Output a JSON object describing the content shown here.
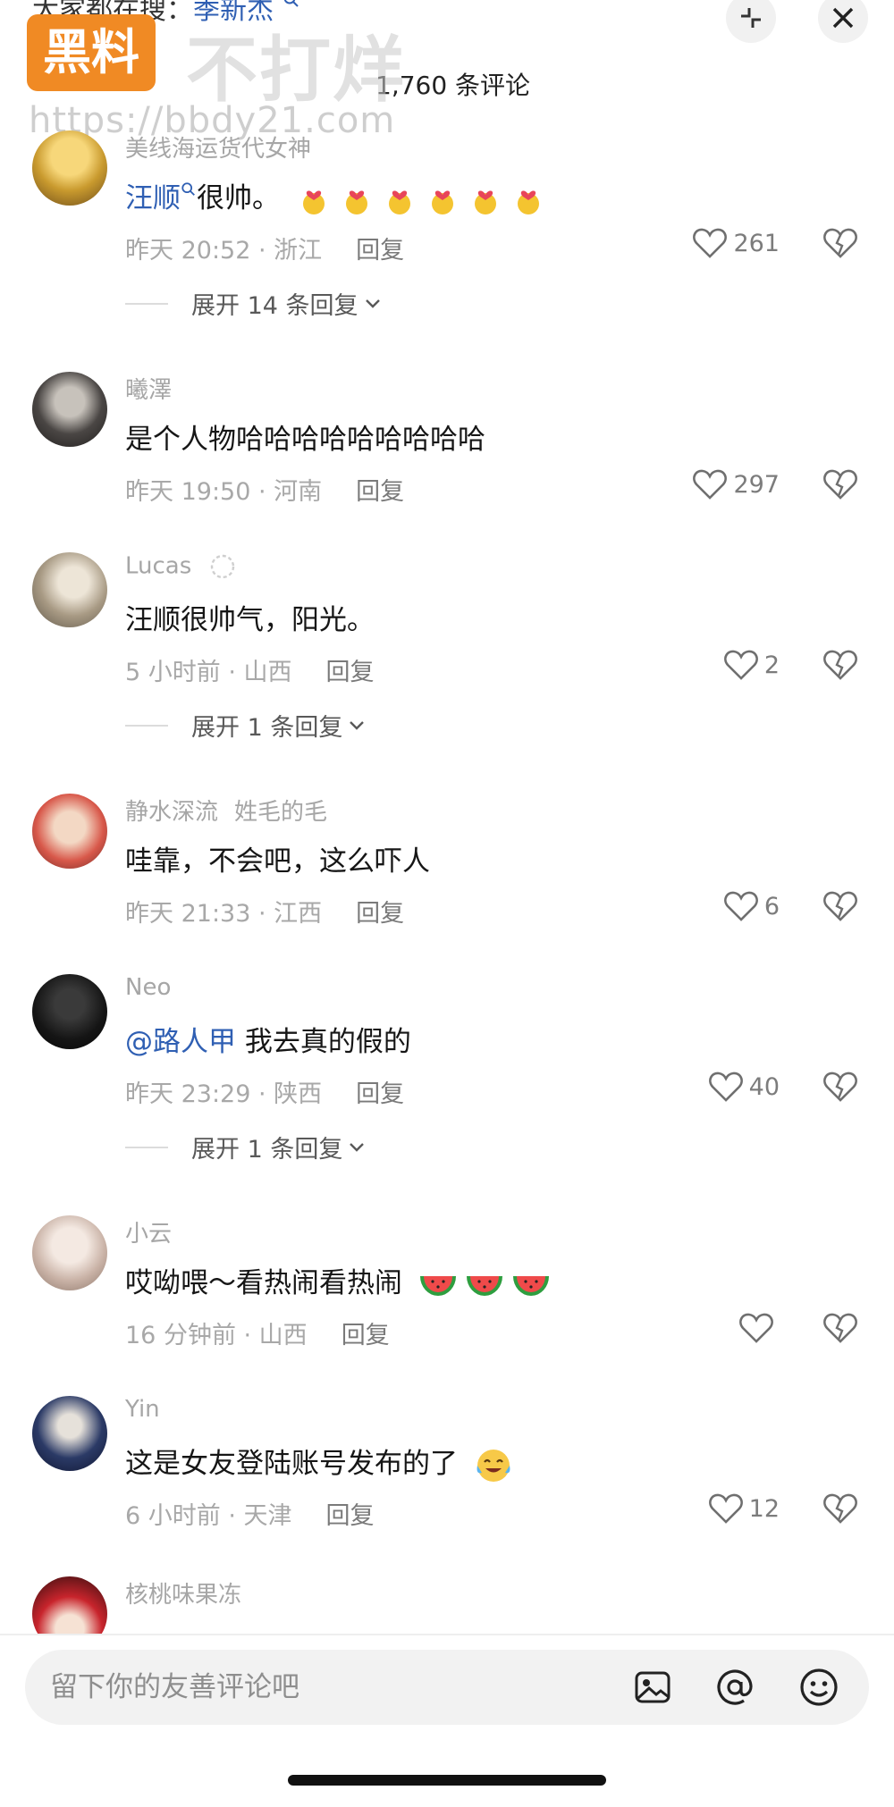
{
  "header": {
    "search_prefix": "大家都在搜：",
    "search_keyword": "季新杰",
    "comment_count": "1,760 条评论"
  },
  "watermark": {
    "logo_text": "黑料",
    "slogan": "不打烊",
    "url": "https://bbdy21.com"
  },
  "comments": [
    {
      "name": "美线海运货代女神",
      "mention": "汪顺",
      "text": "很帅。",
      "time_loc": "昨天 20:52 · 浙江",
      "reply": "回复",
      "likes": "261",
      "expand": "展开 14 条回复"
    },
    {
      "name": "曦澤",
      "text": "是个人物哈哈哈哈哈哈哈哈哈",
      "time_loc": "昨天 19:50 · 河南",
      "reply": "回复",
      "likes": "297"
    },
    {
      "name": "Lucas",
      "text": "汪顺很帅气，阳光。",
      "time_loc": "5 小时前 · 山西",
      "reply": "回复",
      "likes": "2",
      "expand": "展开 1 条回复"
    },
    {
      "name": "静水深流",
      "name_extra": "姓毛的毛",
      "text": "哇靠，不会吧，这么吓人",
      "time_loc": "昨天 21:33 · 江西",
      "reply": "回复",
      "likes": "6"
    },
    {
      "name": "Neo",
      "mention": "@路人甲",
      "text": " 我去真的假的",
      "time_loc": "昨天 23:29 · 陕西",
      "reply": "回复",
      "likes": "40",
      "expand": "展开 1 条回复"
    },
    {
      "name": "小云",
      "text": "哎呦喂～看热闹看热闹",
      "time_loc": "16 分钟前 · 山西",
      "reply": "回复",
      "likes": ""
    },
    {
      "name": "Yin",
      "text": "这是女友登陆账号发布的了",
      "time_loc": "6 小时前 · 天津",
      "reply": "回复",
      "likes": "12"
    },
    {
      "name": "核桃味果冻"
    }
  ],
  "input": {
    "placeholder": "留下你的友善评论吧"
  },
  "colors": {
    "mention": "#2f5fb3",
    "logo_bg": "#f08a24",
    "meta": "#a8a8a8"
  },
  "icons": {
    "header": [
      "collapse-icon",
      "close-icon"
    ],
    "comment": [
      "heart-icon",
      "broken-heart-icon"
    ],
    "input": [
      "image-icon",
      "at-icon",
      "smiley-icon"
    ]
  }
}
